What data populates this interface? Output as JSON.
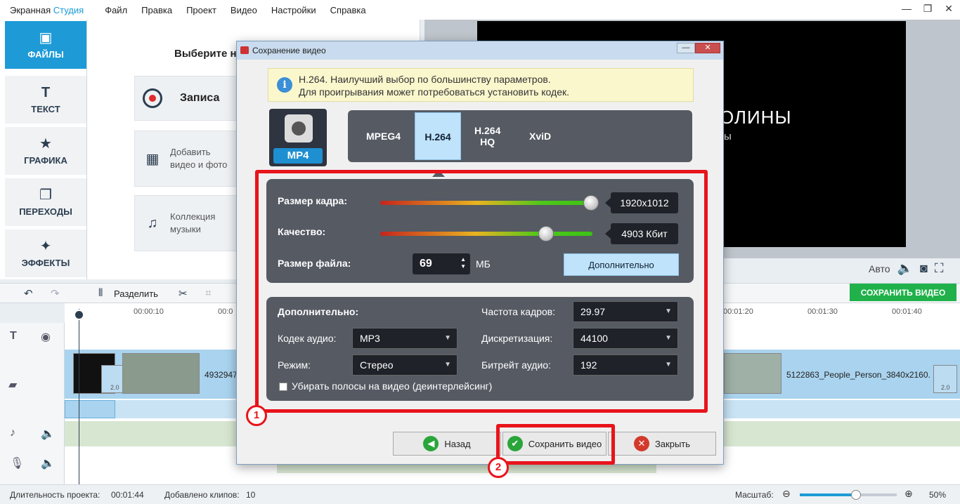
{
  "app": {
    "title_part1": "Экранная ",
    "title_part2": "Студия",
    "menu": [
      "Файл",
      "Правка",
      "Проект",
      "Видео",
      "Настройки",
      "Справка"
    ],
    "window_controls": {
      "minimize": "—",
      "restore": "❐",
      "close": "✕"
    }
  },
  "left_tabs": [
    {
      "label": "ФАЙЛЫ",
      "icon": "image-icon",
      "active": true
    },
    {
      "label": "ТЕКСТ",
      "icon": "text-icon",
      "active": false
    },
    {
      "label": "ГРАФИКА",
      "icon": "star-icon",
      "active": false
    },
    {
      "label": "ПЕРЕХОДЫ",
      "icon": "transitions-icon",
      "active": false
    },
    {
      "label": "ЭФФЕКТЫ",
      "icon": "magic-wand-icon",
      "active": false
    }
  ],
  "files_panel": {
    "title": "Выберите н",
    "record_label": "Записа",
    "add_video_line1": "Добавить",
    "add_video_line2": "видео и фото",
    "music_line1": "Коллекция",
    "music_line2": "музыки"
  },
  "preview": {
    "text_large": "ОЛИНЫ",
    "text_small": "ы",
    "auto_label": "Авто"
  },
  "toolbar": {
    "split_label": "Разделить",
    "save_video_label": "СОХРАНИТЬ ВИДЕО"
  },
  "timeline": {
    "ticks_left": [
      "00:00:10",
      "00:0"
    ],
    "ticks_right": [
      "00:01:20",
      "00:01:30",
      "00:01:40"
    ],
    "clip1_name": "4932947",
    "clip2_name": "5122863_People_Person_3840x2160.",
    "transition_label": "2.0"
  },
  "statusbar": {
    "duration_label": "Длительность проекта:",
    "duration_value": "00:01:44",
    "clips_label": "Добавлено клипов:",
    "clips_value": "10",
    "zoom_label": "Масштаб:",
    "zoom_value": "50%",
    "zoom_fraction": 0.58
  },
  "dialog": {
    "title": "Сохранение видео",
    "info_line1": "H.264. Наилучший выбор по большинству параметров.",
    "info_line2": "Для проигрывания может потребоваться установить кодек.",
    "format_badge": "MP4",
    "codecs": [
      "MPEG4",
      "H.264",
      "H.264\nHQ",
      "XviD"
    ],
    "active_codec": "H.264",
    "frame_size_label": "Размер кадра:",
    "frame_size_value": "1920x1012",
    "frame_size_level": 0.98,
    "quality_label": "Качество:",
    "quality_value": "4903 Кбит",
    "quality_level": 0.78,
    "file_size_label": "Размер файла:",
    "file_size_value": "69",
    "file_size_unit": "МБ",
    "more_button": "Дополнительно",
    "advanced_title": "Дополнительно:",
    "frame_rate_label": "Частота кадров:",
    "frame_rate_value": "29.97",
    "audio_codec_label": "Кодек аудио:",
    "audio_codec_value": "MP3",
    "sampling_label": "Дискретизация:",
    "sampling_value": "44100",
    "mode_label": "Режим:",
    "mode_value": "Стерео",
    "audio_bitrate_label": "Битрейт аудио:",
    "audio_bitrate_value": "192",
    "deinterlace_label": "Убирать полосы на видео (деинтерлейсинг)",
    "back_button": "Назад",
    "save_button": "Сохранить видео",
    "close_button": "Закрыть"
  },
  "annotations": {
    "callout1": "1",
    "callout2": "2",
    "highlight_color": "#e8141b"
  },
  "colors": {
    "accent": "#1e9bd7",
    "save_green": "#20b14a",
    "panel": "#555a63"
  }
}
